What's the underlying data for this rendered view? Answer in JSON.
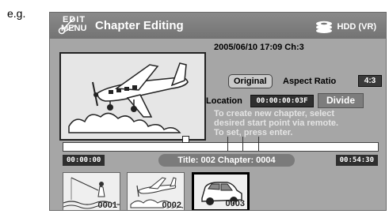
{
  "caption": "e.g.",
  "header": {
    "logo_top": "EDIT",
    "logo_bottom": "MENU",
    "title": "Chapter Editing",
    "drive": "HDD (VR)"
  },
  "info": {
    "datetime": "2005/06/10  17:09  Ch:3",
    "original_label": "Original",
    "aspect_label": "Aspect Ratio",
    "aspect_value": "4:3",
    "location_label": "Location",
    "location_value": "00:00:00:03F",
    "divide_label": "Divide",
    "instructions": [
      "To create new chapter, select",
      "desired start point via remote.",
      "To set, press enter."
    ]
  },
  "timeline": {
    "start_time": "00:00:00",
    "end_time": "00:54:30",
    "title_chapter": "Title: 002  Chapter: 0004"
  },
  "thumbnails": [
    {
      "number": "0001",
      "icon": "fishing-icon",
      "selected": false
    },
    {
      "number": "0002",
      "icon": "airplane-icon",
      "selected": false
    },
    {
      "number": "0003",
      "icon": "car-icon",
      "selected": true
    }
  ],
  "colors": {
    "screen_bg": "#a6a6a6",
    "titlebar_bg": "#7d7d7d",
    "value_box_bg": "#2f2f2f"
  }
}
